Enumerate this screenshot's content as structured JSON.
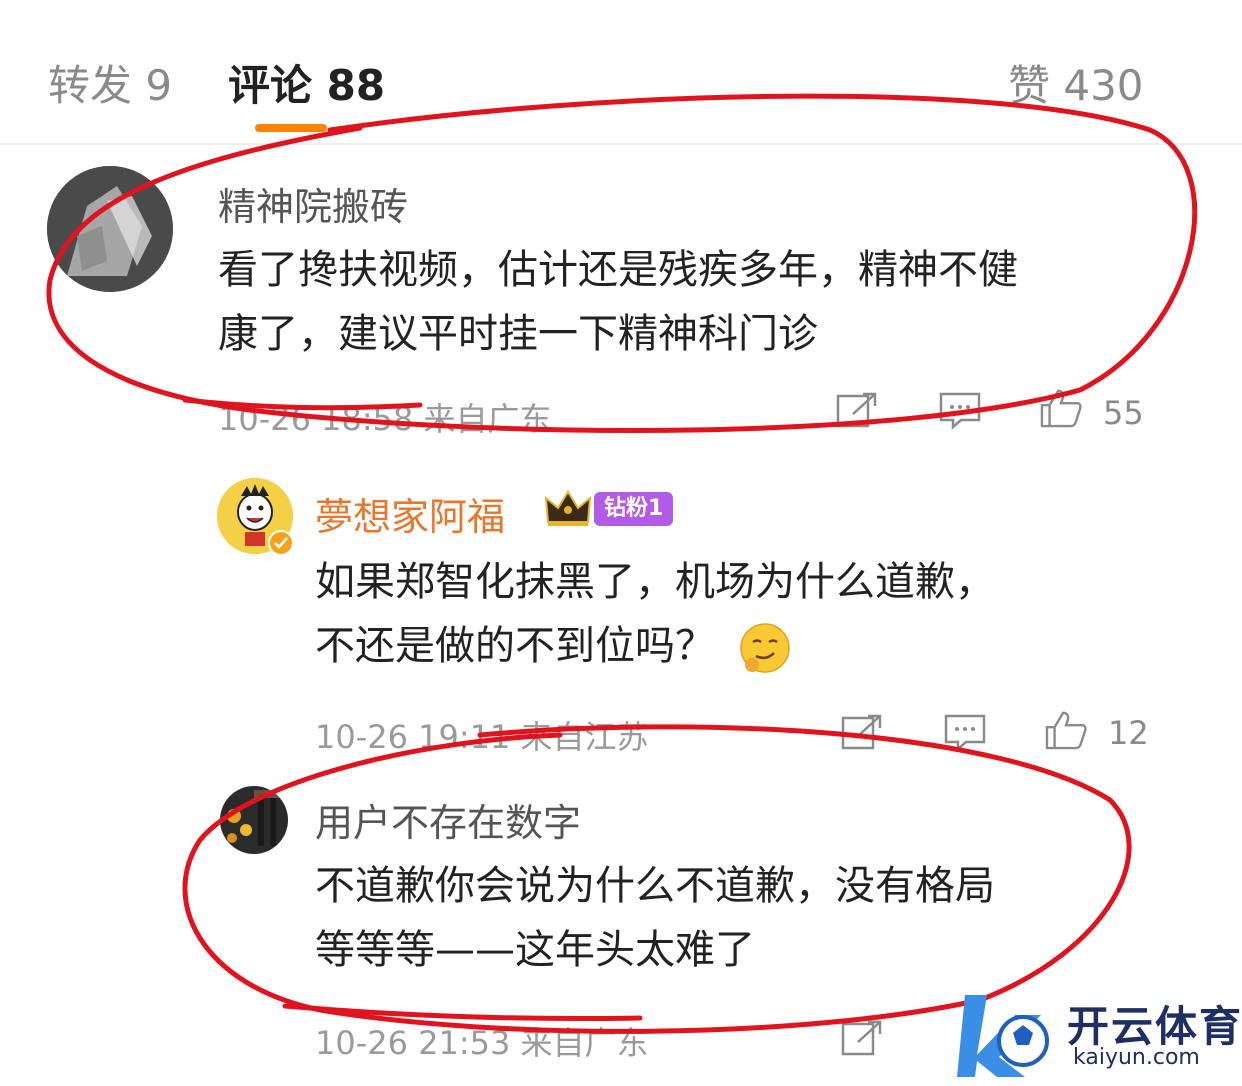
{
  "tabs": {
    "repost": "转发 9",
    "comments": "评论 88",
    "likes": "赞 430"
  },
  "colors": {
    "accent": "#ff8200",
    "annotation": "#e0141e",
    "vip_badge": "#b15be6"
  },
  "comments": [
    {
      "username": "精神院搬砖",
      "text_line1": "看了搀扶视频，估计还是残疾多年，精神不健",
      "text_line2": "康了，建议平时挂一下精神科门诊",
      "meta": "10-26 18:58 来自广东",
      "likes": "55"
    },
    {
      "username": "夢想家阿福",
      "badge": "钻粉1",
      "text_line1": "如果郑智化抹黑了，机场为什么道歉，",
      "text_line2": "不还是做的不到位吗？",
      "meta": "10-26 19:11 来自江苏",
      "likes": "12"
    },
    {
      "username": "用户不存在数字",
      "text_line1": "不道歉你会说为什么不道歉，没有格局",
      "text_line2": "等等等——这年头太难了",
      "meta": "10-26 21:53 来自广东"
    }
  ],
  "watermark": {
    "title": "开云体育",
    "url": "kaiyun.com"
  }
}
